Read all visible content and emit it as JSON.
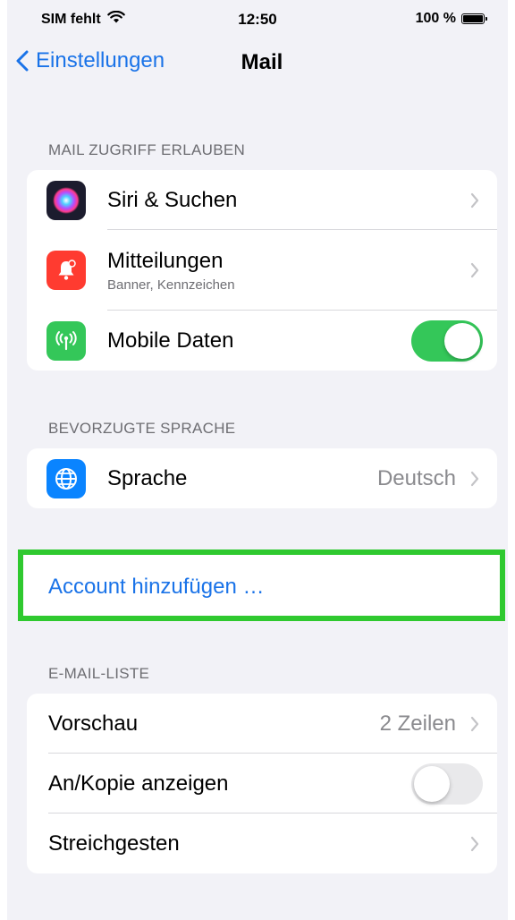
{
  "status": {
    "carrier": "SIM fehlt",
    "time": "12:50",
    "battery": "100 %"
  },
  "nav": {
    "back_label": "Einstellungen",
    "title": "Mail"
  },
  "section_access": {
    "header": "MAIL ZUGRIFF ERLAUBEN",
    "items": [
      {
        "label": "Siri & Suchen"
      },
      {
        "label": "Mitteilungen",
        "subtitle": "Banner, Kennzeichen"
      },
      {
        "label": "Mobile Daten",
        "toggle": true
      }
    ]
  },
  "section_language": {
    "header": "BEVORZUGTE SPRACHE",
    "item": {
      "label": "Sprache",
      "value": "Deutsch"
    }
  },
  "add_account": {
    "label": "Account hinzufügen …"
  },
  "section_list": {
    "header": "E-MAIL-LISTE",
    "items": [
      {
        "label": "Vorschau",
        "value": "2 Zeilen"
      },
      {
        "label": "An/Kopie anzeigen",
        "toggle": false
      },
      {
        "label": "Streichgesten"
      }
    ]
  },
  "colors": {
    "accent": "#1a73e8",
    "toggle_on": "#34c759",
    "highlight": "#2fc92f"
  }
}
